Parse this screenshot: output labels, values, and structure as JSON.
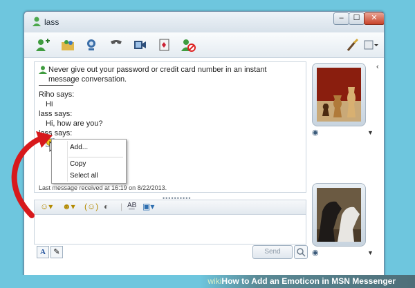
{
  "window": {
    "title": "lass",
    "min_glyph": "–",
    "max_glyph": "☐",
    "close_glyph": "✕"
  },
  "toolbar": {
    "icons": [
      "add-contact-icon",
      "share-folder-icon",
      "webcam-call-icon",
      "phone-icon",
      "video-icon",
      "games-icon",
      "block-icon",
      "paint-icon",
      "options-icon"
    ]
  },
  "conversation": {
    "warning": "Never give out your password or credit card number in an instant message conversation.",
    "messages": [
      {
        "sender": "Riho says:",
        "text": "Hi"
      },
      {
        "sender": "lass says:",
        "text": "Hi, how are you?"
      },
      {
        "sender": "lass says:",
        "text": ""
      }
    ],
    "status": "Last message received at 16:19 on 8/22/2013."
  },
  "context_menu": {
    "items": [
      "Add...",
      "Copy",
      "Select all"
    ]
  },
  "compose": {
    "send_label": "Send",
    "font_label": "A"
  },
  "footer": {
    "brand": "wiki",
    "caption": "How to Add an Emoticon in MSN Messenger"
  },
  "colors": {
    "background": "#6ec6de",
    "arrow": "#d7191c",
    "close_button": "#c8442a"
  }
}
